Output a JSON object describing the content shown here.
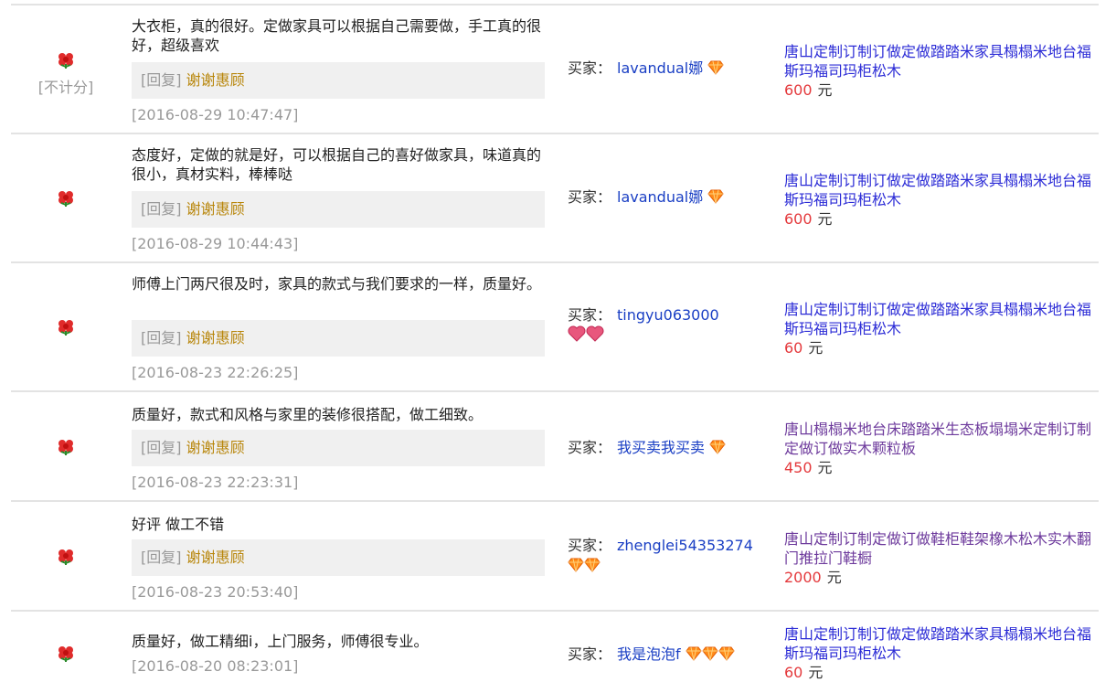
{
  "reviews": [
    {
      "comment": "大衣柜，真的很好。定做家具可以根据自己需要做，手工真的很好，超级喜欢",
      "not_counted": "[不计分]",
      "reply_tag": "[回复]",
      "reply_text": "谢谢惠顾",
      "date": "[2016-08-29 10:47:47]",
      "buyer_label": "买家：",
      "buyer_name": "lavandual娜",
      "buyer_badge": "diamond-icon",
      "buyer_badge_count": 1,
      "item_title": "唐山定制订制订做定做踏踏米家具榻榻米地台福斯玛福司玛柜松木",
      "price": "600",
      "unit": "元"
    },
    {
      "comment": "态度好，定做的就是好，可以根据自己的喜好做家具，味道真的很小，真材实料，棒棒哒",
      "reply_tag": "[回复]",
      "reply_text": "谢谢惠顾",
      "date": "[2016-08-29 10:44:43]",
      "buyer_label": "买家：",
      "buyer_name": "lavandual娜",
      "buyer_badge": "diamond-icon",
      "buyer_badge_count": 1,
      "item_title": "唐山定制订制订做定做踏踏米家具榻榻米地台福斯玛福司玛柜松木",
      "price": "600",
      "unit": "元"
    },
    {
      "comment": "师傅上门两尺很及时，家具的款式与我们要求的一样，质量好。",
      "reply_tag": "[回复]",
      "reply_text": "谢谢惠顾",
      "date": "[2016-08-23 22:26:25]",
      "buyer_label": "买家：",
      "buyer_name": "tingyu063000",
      "buyer_badge": "heart-icon",
      "buyer_badge_count": 2,
      "item_title": "唐山定制订制订做定做踏踏米家具榻榻米地台福斯玛福司玛柜松木",
      "price": "60",
      "unit": "元"
    },
    {
      "comment": "质量好，款式和风格与家里的装修很搭配，做工细致。",
      "reply_tag": "[回复]",
      "reply_text": "谢谢惠顾",
      "date": "[2016-08-23 22:23:31]",
      "buyer_label": "买家：",
      "buyer_name": "我买卖我买卖",
      "buyer_badge": "diamond-icon",
      "buyer_badge_count": 1,
      "item_title": "唐山榻榻米地台床踏踏米生态板塌塌米定制订制定做订做实木颗粒板",
      "price": "450",
      "unit": "元"
    },
    {
      "comment": "好评 做工不错",
      "reply_tag": "[回复]",
      "reply_text": "谢谢惠顾",
      "date": "[2016-08-23 20:53:40]",
      "buyer_label": "买家：",
      "buyer_name": "zhenglei54353274",
      "buyer_badge": "diamond-icon",
      "buyer_badge_count": 2,
      "item_title": "唐山定制订制定做订做鞋柜鞋架橡木松木实木翻门推拉门鞋橱",
      "price": "2000",
      "unit": "元"
    },
    {
      "comment": "质量好，做工精细i，上门服务，师傅很专业。",
      "date": "[2016-08-20 08:23:01]",
      "buyer_label": "买家：",
      "buyer_name": "我是泡泡f",
      "buyer_badge": "diamond-icon",
      "buyer_badge_count": 3,
      "item_title": "唐山定制订制订做定做踏踏米家具榻榻米地台福斯玛福司玛柜松木",
      "price": "60",
      "unit": "元"
    }
  ],
  "colors": {
    "price": "#e4393c",
    "link": "#2b2bd6",
    "visited": "#6d3a9c",
    "reply": "#b8860b"
  }
}
